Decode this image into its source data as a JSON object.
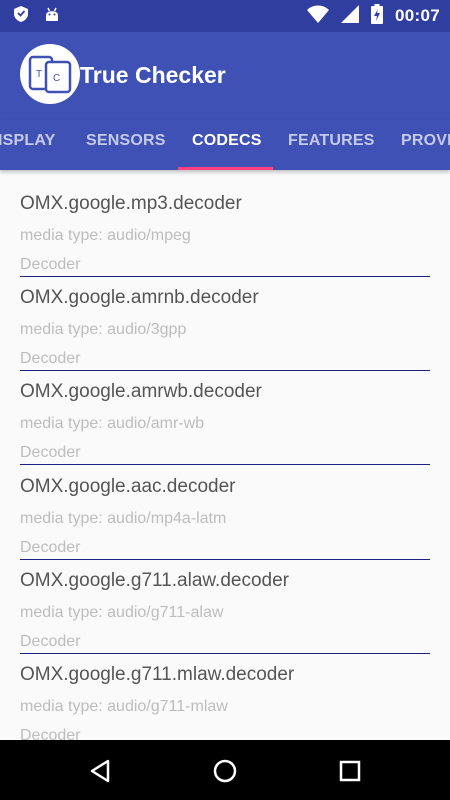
{
  "status_bar": {
    "time": "00:07",
    "icons": [
      "shield-icon",
      "android-icon",
      "wifi-icon",
      "signal-icon",
      "battery-charging-icon"
    ]
  },
  "app": {
    "title": "True Checker",
    "logo_letters": [
      "T",
      "C"
    ]
  },
  "tabs": [
    {
      "label": "ISPLAY",
      "active": false
    },
    {
      "label": "SENSORS",
      "active": false
    },
    {
      "label": "CODECS",
      "active": true
    },
    {
      "label": "FEATURES",
      "active": false
    },
    {
      "label": "PROVI",
      "active": false
    }
  ],
  "codecs": [
    {
      "name": "OMX.google.mp3.decoder",
      "media_type": "media type: audio/mpeg",
      "kind": "Decoder"
    },
    {
      "name": "OMX.google.amrnb.decoder",
      "media_type": "media type: audio/3gpp",
      "kind": "Decoder"
    },
    {
      "name": "OMX.google.amrwb.decoder",
      "media_type": "media type: audio/amr-wb",
      "kind": "Decoder"
    },
    {
      "name": "OMX.google.aac.decoder",
      "media_type": "media type: audio/mp4a-latm",
      "kind": "Decoder"
    },
    {
      "name": "OMX.google.g711.alaw.decoder",
      "media_type": "media type: audio/g711-alaw",
      "kind": "Decoder"
    },
    {
      "name": "OMX.google.g711.mlaw.decoder",
      "media_type": "media type: audio/g711-mlaw",
      "kind": "Decoder"
    }
  ],
  "nav": {
    "icons": [
      "back-icon",
      "home-icon",
      "recents-icon"
    ]
  },
  "colors": {
    "primary": "#3f51b5",
    "primary_dark": "#303f9f",
    "accent": "#ff4081",
    "divider": "#1a237e"
  }
}
